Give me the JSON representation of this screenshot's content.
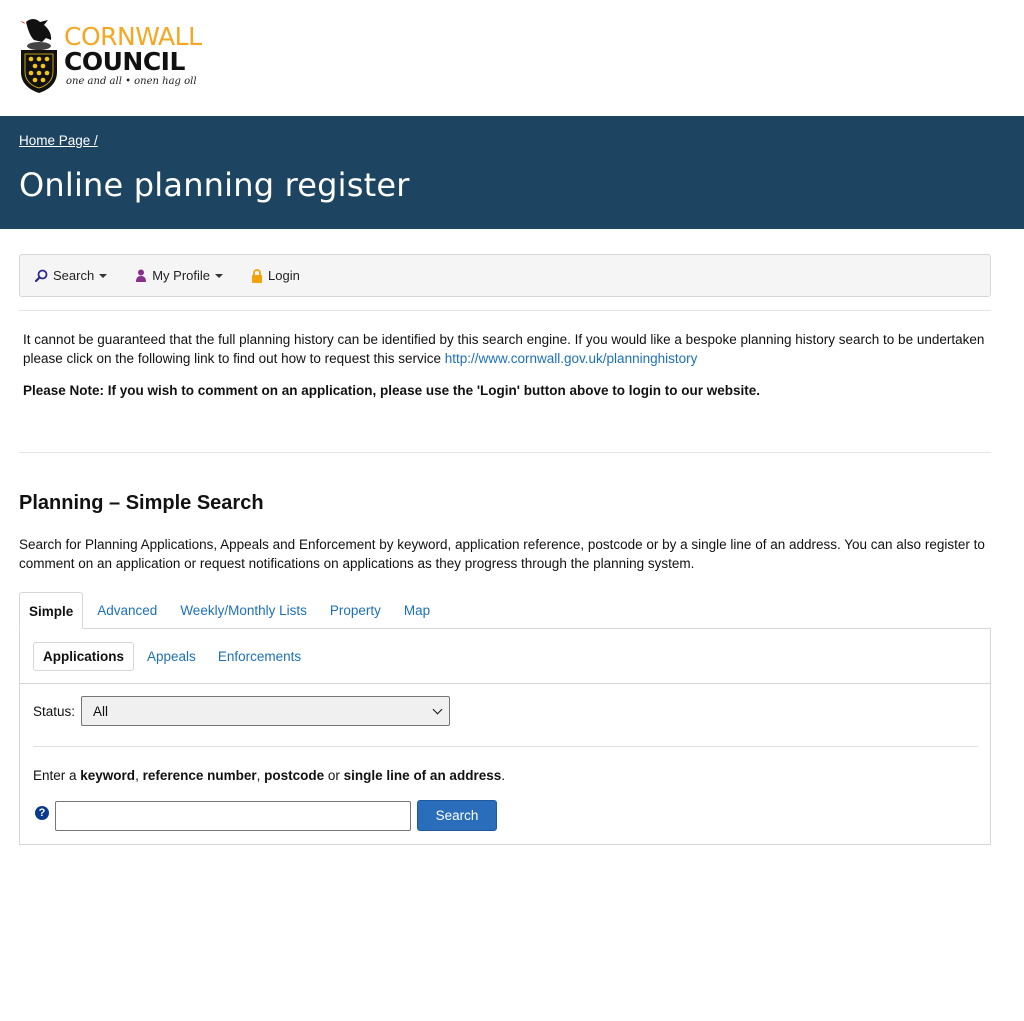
{
  "logo": {
    "line1": "CORNWALL",
    "line2": "COUNCIL",
    "motto": "one and all • onen hag oll"
  },
  "banner": {
    "breadcrumb": "Home Page /",
    "title": "Online planning register",
    "background": "#1d4460"
  },
  "navbar": {
    "items": [
      {
        "label": "Search",
        "icon": "search-icon",
        "dropdown": true
      },
      {
        "label": "My Profile",
        "icon": "user-icon",
        "dropdown": true
      },
      {
        "label": "Login",
        "icon": "lock-icon",
        "dropdown": false
      }
    ]
  },
  "notice": {
    "text": "It cannot be guaranteed that the full planning history can be identified by this search engine.  If you would like a bespoke planning history search to be undertaken please click on the following link to find out how to request this service ",
    "link": "http://www.cornwall.gov.uk/planninghistory",
    "note": "Please Note: If you wish to comment on an application, please use the 'Login' button above to login to our website."
  },
  "section": {
    "title_bold": "Planning",
    "title_rest": " – Simple Search",
    "description": "Search for Planning Applications, Appeals and Enforcement by keyword, application reference, postcode or by a single line of an address. You can also register to comment on an application or request notifications on applications as they progress through the planning system."
  },
  "tabs": [
    {
      "label": "Simple",
      "active": true
    },
    {
      "label": "Advanced",
      "active": false
    },
    {
      "label": "Weekly/Monthly Lists",
      "active": false
    },
    {
      "label": "Property",
      "active": false
    },
    {
      "label": "Map",
      "active": false
    }
  ],
  "subtabs": [
    {
      "label": "Applications",
      "active": true
    },
    {
      "label": "Appeals",
      "active": false
    },
    {
      "label": "Enforcements",
      "active": false
    }
  ],
  "form": {
    "status_label": "Status:",
    "status_value": "All",
    "enter_prefix": "Enter a ",
    "enter_keyword": "keyword",
    "enter_sep1": ", ",
    "enter_reference": "reference number",
    "enter_sep2": ", ",
    "enter_postcode": "postcode",
    "enter_or": " or ",
    "enter_address": "single line of an address",
    "enter_suffix": ".",
    "help_glyph": "?",
    "search_value": "",
    "search_button": "Search"
  },
  "colors": {
    "accent": "#1d70b8",
    "button": "#2a6ebb",
    "logo_orange": "#f5a623"
  }
}
